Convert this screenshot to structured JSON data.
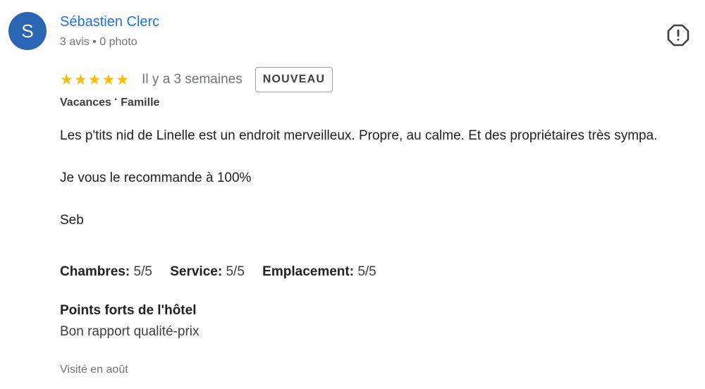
{
  "reviewer": {
    "initial": "S",
    "name": "Sébastien Clerc",
    "meta": "3 avis • 0 photo"
  },
  "rating": {
    "stars": 5,
    "max_stars": 5,
    "date": "Il y a 3 semaines",
    "badge": "NOUVEAU"
  },
  "trip": {
    "type": "Vacances",
    "separator": "·",
    "companions": "Famille"
  },
  "review": {
    "paragraphs": [
      "Les p'tits nid de Linelle est un endroit merveilleux. Propre, au calme. Et des propriétaires très sympa.",
      "Je vous le recommande à 100%",
      "Seb"
    ]
  },
  "sub_ratings": [
    {
      "label": "Chambres:",
      "value": "5/5"
    },
    {
      "label": "Service:",
      "value": "5/5"
    },
    {
      "label": "Emplacement:",
      "value": "5/5"
    }
  ],
  "highlights": {
    "title": "Points forts de l'hôtel",
    "value": "Bon rapport qualité-prix"
  },
  "visited": "Visité en août",
  "icons": {
    "report": "report-flag-icon",
    "star": "star-icon"
  },
  "colors": {
    "avatar": "#2a66b4",
    "name": "#1a73e8",
    "star": "#fbbc04"
  }
}
